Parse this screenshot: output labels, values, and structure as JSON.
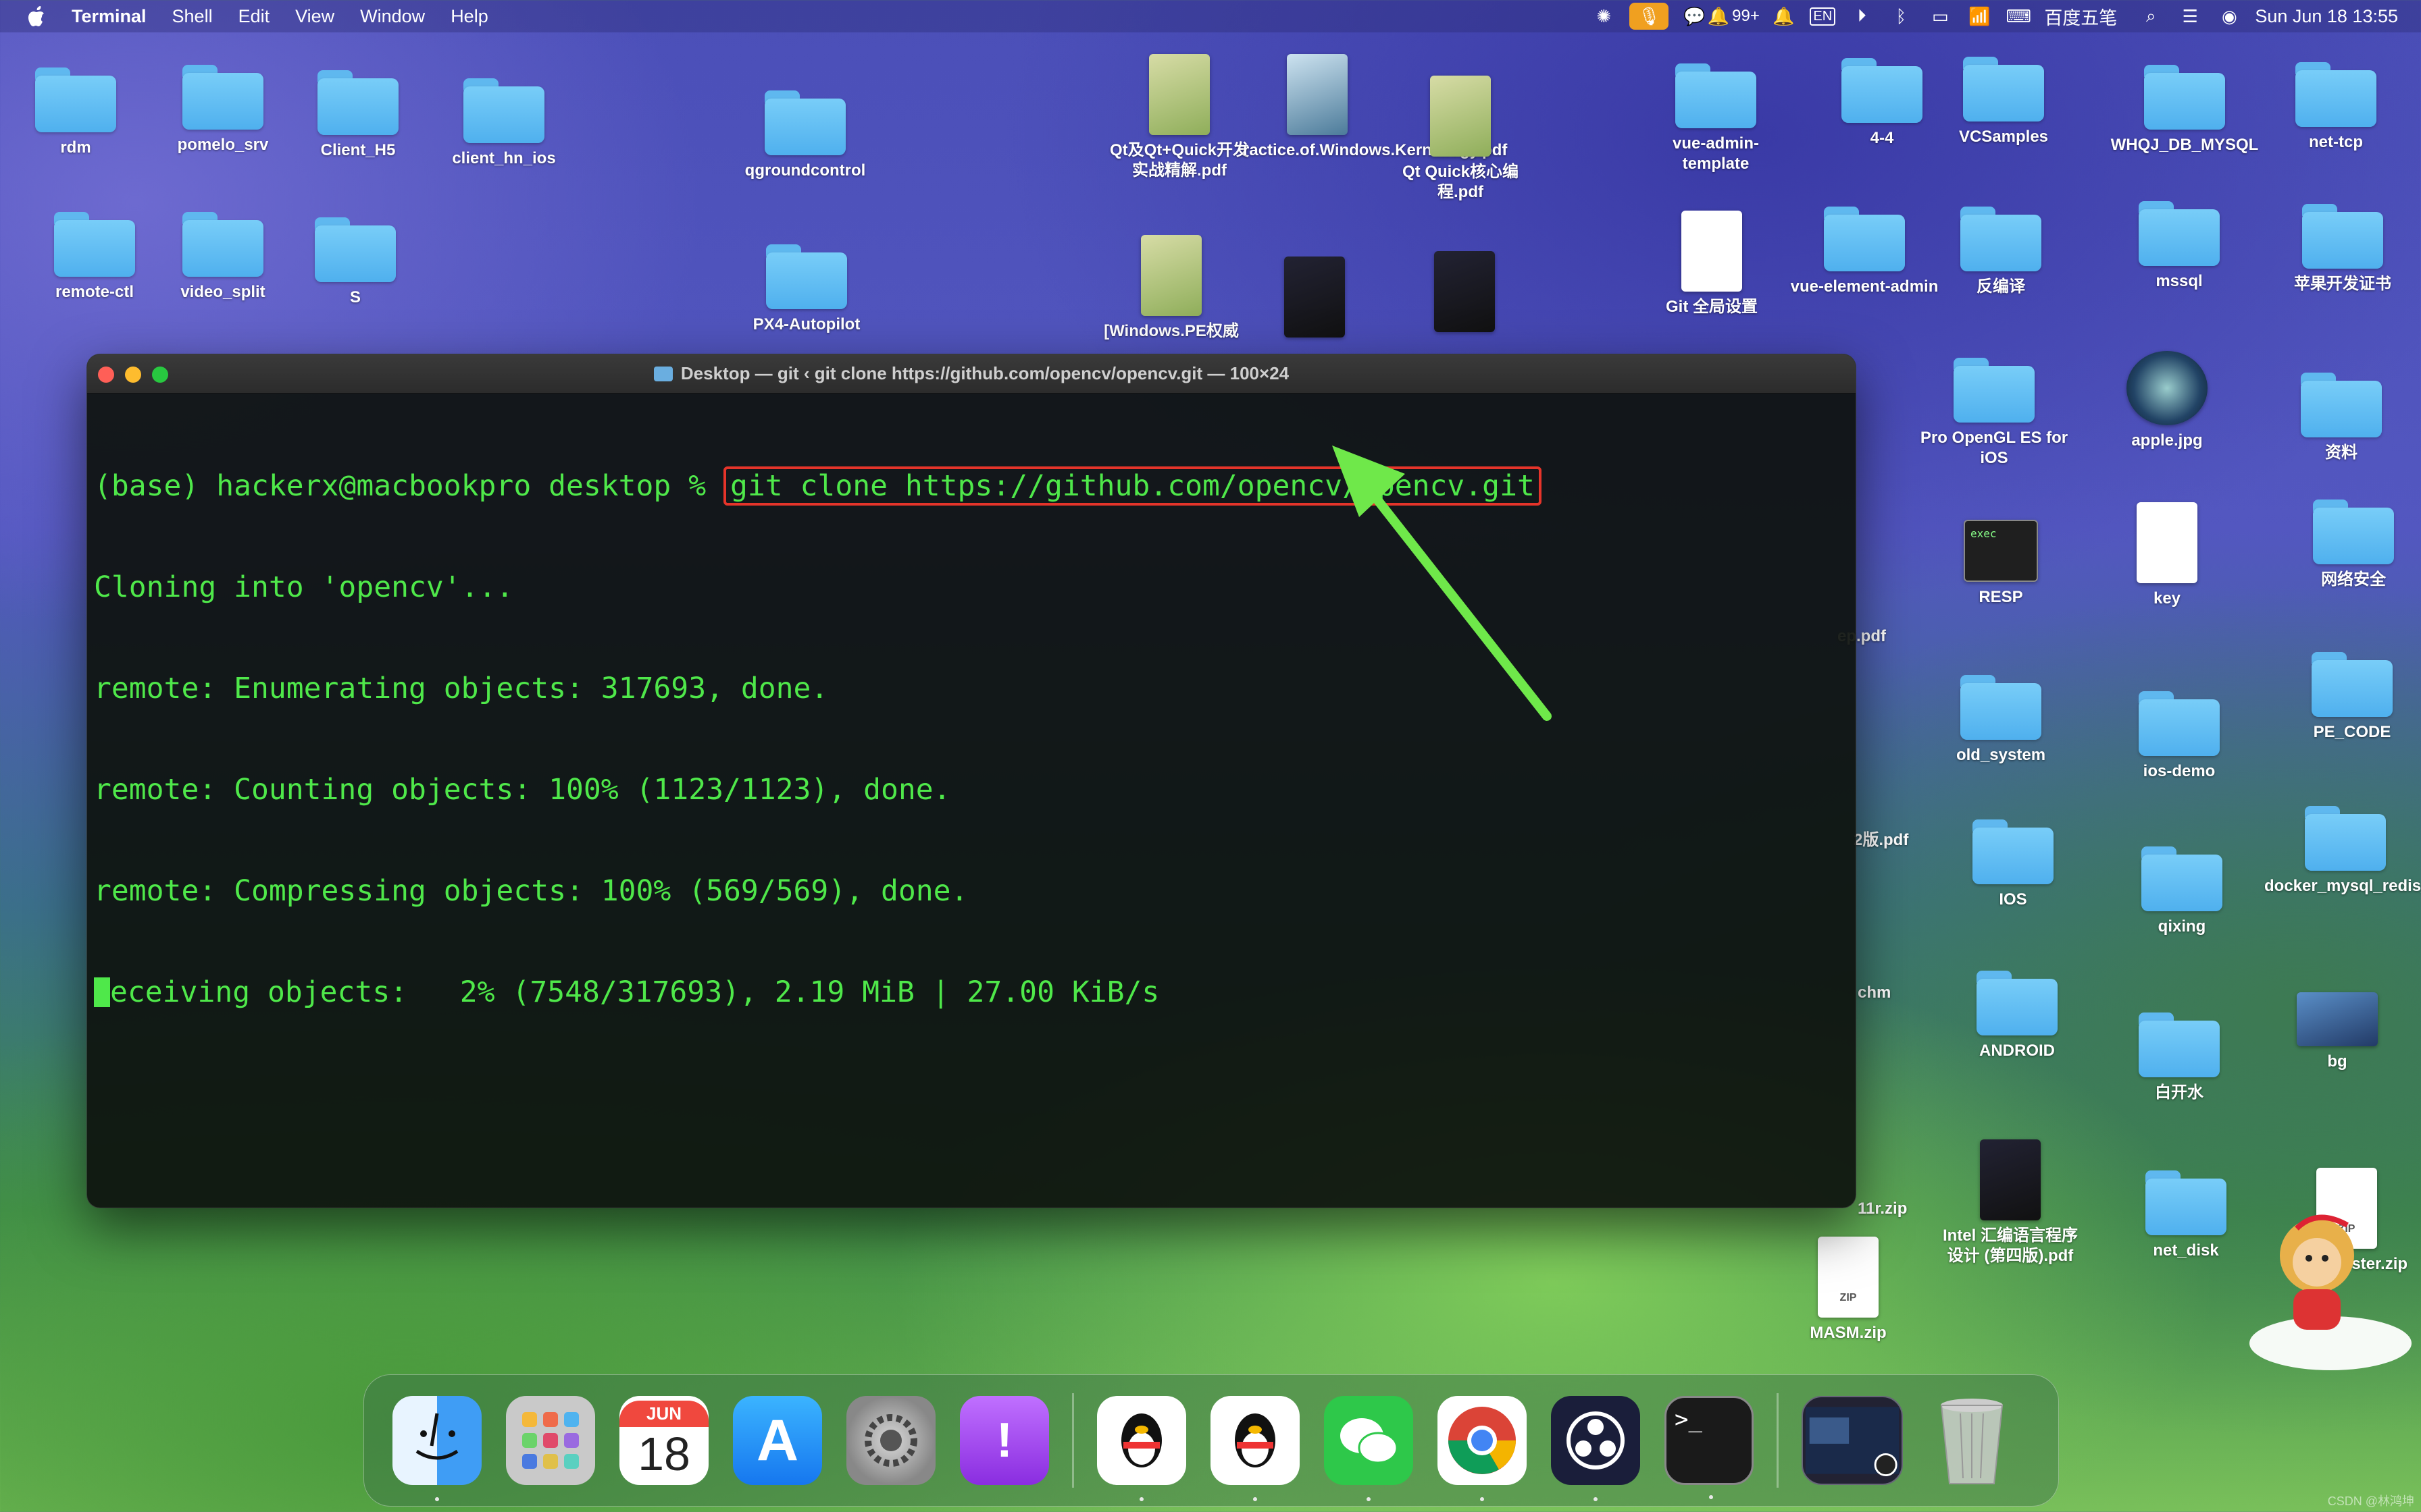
{
  "menubar": {
    "app_name": "Terminal",
    "items": [
      "Shell",
      "Edit",
      "View",
      "Window",
      "Help"
    ],
    "notification_badge": "99+",
    "input_lang": "EN",
    "ime_name": "百度五笔",
    "datetime": "Sun Jun 18  13:55"
  },
  "desktop": {
    "items": [
      {
        "label": "rdm",
        "kind": "folder"
      },
      {
        "label": "pomelo_srv",
        "kind": "folder"
      },
      {
        "label": "Client_H5",
        "kind": "folder"
      },
      {
        "label": "client_hn_ios",
        "kind": "folder"
      },
      {
        "label": "qgroundcontrol",
        "kind": "folder"
      },
      {
        "label": "Qt及Qt+Quick开发实战精解.pdf",
        "kind": "book"
      },
      {
        "label": "ractice.of.Windows.Kern...logy.pdf",
        "kind": "book3"
      },
      {
        "label": "Qt Quick核心编程.pdf",
        "kind": "book"
      },
      {
        "label": "vue-admin-template",
        "kind": "folder"
      },
      {
        "label": "4-4",
        "kind": "folder"
      },
      {
        "label": "VCSamples",
        "kind": "folder"
      },
      {
        "label": "WHQJ_DB_MYSQL",
        "kind": "folder"
      },
      {
        "label": "net-tcp",
        "kind": "folder"
      },
      {
        "label": "remote-ctl",
        "kind": "folder"
      },
      {
        "label": "video_split",
        "kind": "folder"
      },
      {
        "label": "S",
        "kind": "folder"
      },
      {
        "label": "PX4-Autopilot",
        "kind": "folder"
      },
      {
        "label": "[Windows.PE权威",
        "kind": "book"
      },
      {
        "label": "Git 全局设置",
        "kind": "doc"
      },
      {
        "label": "vue-element-admin",
        "kind": "folder"
      },
      {
        "label": "反编译",
        "kind": "folder"
      },
      {
        "label": "mssql",
        "kind": "folder"
      },
      {
        "label": "苹果开发证书",
        "kind": "folder"
      },
      {
        "label": "Pro OpenGL ES for iOS",
        "kind": "folder"
      },
      {
        "label": "apple.jpg",
        "kind": "img"
      },
      {
        "label": "资料",
        "kind": "folder"
      },
      {
        "label": "RESP",
        "kind": "exec"
      },
      {
        "label": "key",
        "kind": "doc"
      },
      {
        "label": "网络安全",
        "kind": "folder"
      },
      {
        "label": "old_system",
        "kind": "folder"
      },
      {
        "label": "ios-demo",
        "kind": "folder"
      },
      {
        "label": "PE_CODE",
        "kind": "folder"
      },
      {
        "label": "IOS",
        "kind": "folder"
      },
      {
        "label": "qixing",
        "kind": "folder"
      },
      {
        "label": "docker_mysql_redis_mongodb",
        "kind": "folder"
      },
      {
        "label": "ANDROID",
        "kind": "folder"
      },
      {
        "label": "白开水",
        "kind": "folder"
      },
      {
        "label": "bg",
        "kind": "bgimg"
      },
      {
        "label": "Intel 汇编语言程序设计 (第四版).pdf",
        "kind": "book2"
      },
      {
        "label": "net_disk",
        "kind": "folder"
      },
      {
        "label": "MASM.zip",
        "kind": "zip"
      },
      {
        "label": "ер.pdf",
        "kind": "none"
      },
      {
        "label": "2版.pdf",
        "kind": "none"
      },
      {
        "label": "chm",
        "kind": "none"
      },
      {
        "label": "11r.zip",
        "kind": "none"
      },
      {
        "label": "efSharp-ster.zip",
        "kind": "zip"
      }
    ]
  },
  "terminal": {
    "title": "Desktop — git ‹ git clone https://github.com/opencv/opencv.git — 100×24",
    "prompt": "(base) hackerx@macbookpro desktop % ",
    "command": "git clone https://github.com/opencv/opencv.git",
    "output": [
      "Cloning into 'opencv'...",
      "remote: Enumerating objects: 317693, done.",
      "remote: Counting objects: 100% (1123/1123), done.",
      "remote: Compressing objects: 100% (569/569), done."
    ],
    "progress_line": "eceiving objects:   2% (7548/317693), 2.19 MiB | 27.00 KiB/s"
  },
  "dock": {
    "calendar_month": "JUN",
    "calendar_day": "18",
    "terminal_glyph": ">_",
    "apps": [
      "finder-icon",
      "launchpad-icon",
      "calendar-icon",
      "app-store-icon",
      "system-settings-icon",
      "feedback-icon",
      "qq-icon",
      "qq-icon",
      "wechat-icon",
      "chrome-icon",
      "obs-icon",
      "terminal-icon",
      "preview-thumbnail",
      "trash-icon"
    ]
  },
  "watermark": "CSDN @林鸿坤",
  "colors": {
    "terminal_text": "#4fe84a",
    "highlight_box": "#e5342a",
    "arrow": "#6fe84a"
  }
}
